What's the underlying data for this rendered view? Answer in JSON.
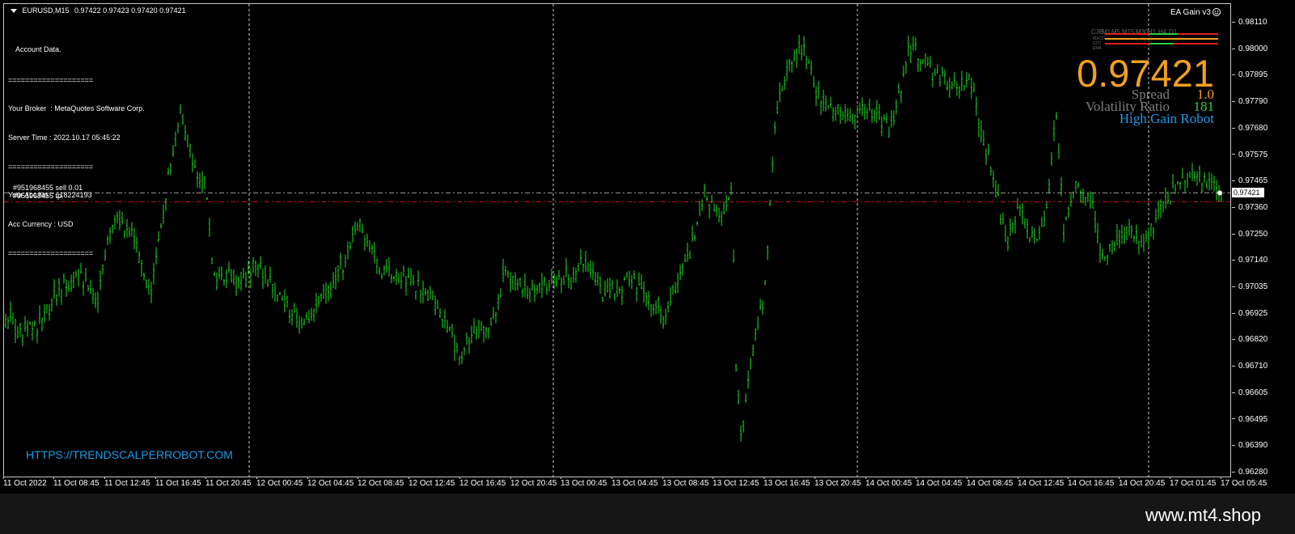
{
  "header": {
    "symbol": "EURUSD,M15",
    "quote": "0.97422 0.97423 0.97420 0.97421"
  },
  "account": {
    "title": "Account Data.",
    "separator": "====================",
    "broker": "Your Broker  : MetaQuotes Software Corp.",
    "server_time": "Server Time : 2022.10.17 05:45:22",
    "acc_no": "Your Acc.No  : 118224193",
    "currency": "Acc Currency : USD"
  },
  "ea": {
    "name": "EA Gain  v3",
    "icon": "smiley-icon",
    "current_price": "0.97421",
    "spread_label": "Spread",
    "spread_value": "1.0",
    "volatility_label": "Volatility Ratio",
    "volatility_value": "181",
    "robot_name": "High Gain Robot",
    "timeframes": [
      "CJB",
      "M1",
      "M5",
      "M15",
      "M30",
      "H1",
      "H4",
      "D1"
    ],
    "indicators": [
      "MACD",
      "STO",
      "EMA"
    ],
    "colors": {
      "accent": "#f0a020",
      "bull": "#2ecc40",
      "bear": "#e02020",
      "info": "#1e9be9",
      "muted": "#7f7f7f"
    }
  },
  "orders": {
    "sell_label": "#951968455 sell 0.01",
    "tp_label": "#951968455 tp",
    "current_price_box": "0.97421"
  },
  "url_text": "HTTPS://TRENDSCALPERROBOT.COM",
  "watermark": "www.mt4.shop",
  "price_axis": [
    "0.98110",
    "0.98000",
    "0.97895",
    "0.97790",
    "0.97680",
    "0.97575",
    "0.97465",
    "0.97360",
    "0.97250",
    "0.97140",
    "0.97035",
    "0.96925",
    "0.96820",
    "0.96710",
    "0.96605",
    "0.96495",
    "0.96390",
    "0.96280"
  ],
  "time_axis": [
    "11 Oct 2022",
    "11 Oct 08:45",
    "11 Oct 12:45",
    "11 Oct 16:45",
    "11 Oct 20:45",
    "12 Oct 00:45",
    "12 Oct 04:45",
    "12 Oct 08:45",
    "12 Oct 12:45",
    "12 Oct 16:45",
    "12 Oct 20:45",
    "13 Oct 00:45",
    "13 Oct 04:45",
    "13 Oct 08:45",
    "13 Oct 12:45",
    "13 Oct 16:45",
    "13 Oct 20:45",
    "14 Oct 00:45",
    "14 Oct 04:45",
    "14 Oct 08:45",
    "14 Oct 12:45",
    "14 Oct 16:45",
    "14 Oct 20:45",
    "17 Oct 01:45",
    "17 Oct 05:45"
  ],
  "chart_data": {
    "type": "line",
    "symbol": "EURUSD",
    "timeframe": "M15",
    "ylim": [
      0.9628,
      0.9816
    ],
    "series": [
      {
        "name": "EURUSD",
        "x": [
          "11 Oct 2022",
          "11 Oct 08:45",
          "11 Oct 12:45",
          "11 Oct 16:45",
          "11 Oct 20:45",
          "12 Oct 00:45",
          "12 Oct 04:45",
          "12 Oct 08:45",
          "12 Oct 12:45",
          "12 Oct 16:45",
          "12 Oct 20:45",
          "13 Oct 00:45",
          "13 Oct 04:45",
          "13 Oct 08:45",
          "13 Oct 12:45",
          "13 Oct 16:45",
          "13 Oct 20:45",
          "14 Oct 00:45",
          "14 Oct 04:45",
          "14 Oct 08:45",
          "14 Oct 12:45",
          "14 Oct 16:45",
          "14 Oct 20:45",
          "17 Oct 01:45",
          "17 Oct 05:45"
        ],
        "values": [
          0.969,
          0.9702,
          0.973,
          0.9752,
          0.9705,
          0.9705,
          0.9698,
          0.9722,
          0.9705,
          0.9688,
          0.97,
          0.9708,
          0.97,
          0.9703,
          0.97,
          0.979,
          0.9778,
          0.9792,
          0.979,
          0.9765,
          0.973,
          0.9735,
          0.972,
          0.9745,
          0.9742
        ]
      }
    ],
    "horizontal_lines": [
      {
        "price": 0.97421,
        "label": "#951968455 sell 0.01"
      },
      {
        "price": 0.974,
        "label": "#951968455 tp"
      }
    ]
  }
}
